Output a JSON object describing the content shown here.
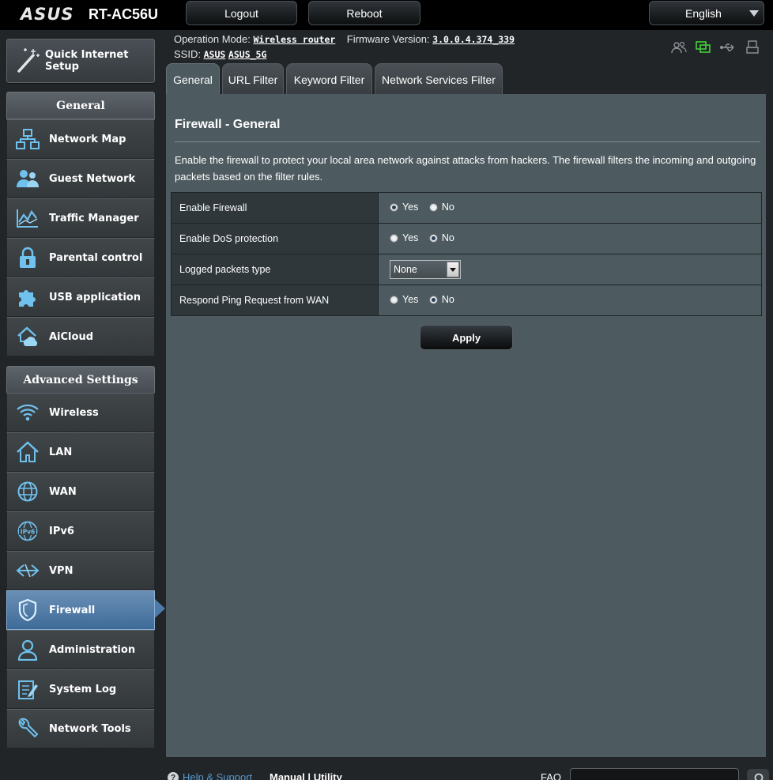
{
  "header": {
    "brand": "ASUS",
    "model": "RT-AC56U",
    "logout_label": "Logout",
    "reboot_label": "Reboot",
    "language": "English"
  },
  "info": {
    "op_mode_label": "Operation Mode:",
    "op_mode_value": "Wireless router",
    "firmware_label": "Firmware Version:",
    "firmware_value": "3.0.0.4.374_339",
    "ssid_label": "SSID:",
    "ssid_1": "ASUS",
    "ssid_2": "ASUS_5G"
  },
  "sidebar": {
    "quick_setup": "Quick Internet Setup",
    "general_head": "General",
    "general_items": [
      {
        "label": "Network Map",
        "icon": "network-map-icon"
      },
      {
        "label": "Guest Network",
        "icon": "guest-network-icon"
      },
      {
        "label": "Traffic Manager",
        "icon": "traffic-manager-icon"
      },
      {
        "label": "Parental control",
        "icon": "lock-icon"
      },
      {
        "label": "USB application",
        "icon": "puzzle-icon"
      },
      {
        "label": "AiCloud",
        "icon": "cloud-home-icon"
      }
    ],
    "advanced_head": "Advanced Settings",
    "advanced_items": [
      {
        "label": "Wireless",
        "icon": "wifi-icon"
      },
      {
        "label": "LAN",
        "icon": "home-icon"
      },
      {
        "label": "WAN",
        "icon": "globe-icon"
      },
      {
        "label": "IPv6",
        "icon": "ipv6-icon"
      },
      {
        "label": "VPN",
        "icon": "vpn-icon"
      },
      {
        "label": "Firewall",
        "icon": "shield-icon"
      },
      {
        "label": "Administration",
        "icon": "user-icon"
      },
      {
        "label": "System Log",
        "icon": "log-icon"
      },
      {
        "label": "Network Tools",
        "icon": "wrench-icon"
      }
    ]
  },
  "tabs": [
    {
      "label": "General",
      "active": true
    },
    {
      "label": "URL Filter",
      "active": false
    },
    {
      "label": "Keyword Filter",
      "active": false
    },
    {
      "label": "Network Services Filter",
      "active": false
    }
  ],
  "main": {
    "title": "Firewall - General",
    "description": "Enable the firewall to protect your local area network against attacks from hackers. The firewall filters the incoming and outgoing packets based on the filter rules.",
    "rows": {
      "enable_firewall": {
        "label": "Enable Firewall",
        "yes": "Yes",
        "no": "No",
        "selected": "Yes"
      },
      "dos_protection": {
        "label": "Enable DoS protection",
        "yes": "Yes",
        "no": "No",
        "selected": "No"
      },
      "logged_packets": {
        "label": "Logged packets type",
        "value": "None"
      },
      "ping_wan": {
        "label": "Respond Ping Request from WAN",
        "yes": "Yes",
        "no": "No",
        "selected": "No"
      }
    },
    "apply_label": "Apply"
  },
  "footer": {
    "help": "Help & Support",
    "manual": "Manual",
    "separator": "|",
    "utility": "Utility",
    "faq": "FAQ"
  },
  "colors": {
    "panel_bg": "#4d5a60",
    "active_nav": "#4d7aa8",
    "icon_blue": "#6fc1ee",
    "status_green": "#40d13a"
  }
}
